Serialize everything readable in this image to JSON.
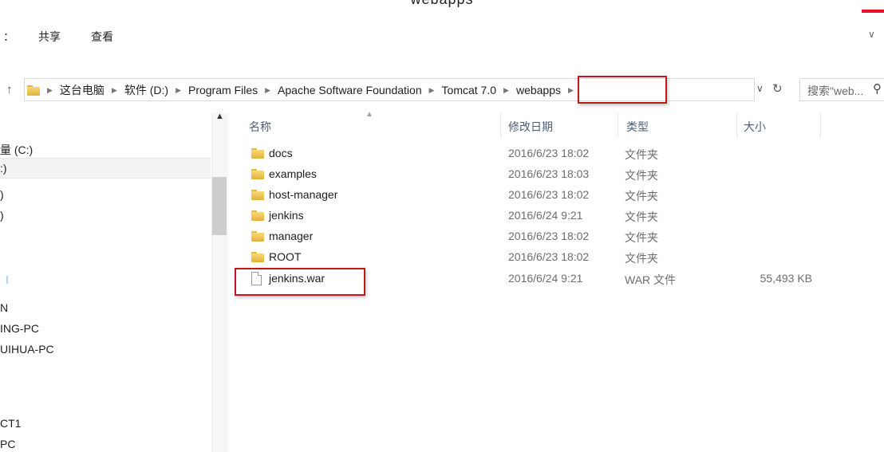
{
  "window": {
    "title": "webapps"
  },
  "menu": {
    "left_mark": "：",
    "items": [
      "共享",
      "查看"
    ],
    "toggle": "∨"
  },
  "address": {
    "up": "↑",
    "crumbs": [
      "这台电脑",
      "软件 (D:)",
      "Program Files",
      "Apache Software Foundation",
      "Tomcat 7.0",
      "webapps"
    ],
    "dropdown": "∨",
    "refresh": "↻"
  },
  "search": {
    "placeholder": "搜索\"web...",
    "icon": "search-icon"
  },
  "nav": {
    "items": [
      "量 (C:)",
      ":)",
      ")",
      ")",
      "N",
      "ING-PC",
      "UIHUA-PC",
      "CT1",
      "PC"
    ]
  },
  "columns": {
    "name": "名称",
    "date": "修改日期",
    "type": "类型",
    "size": "大小"
  },
  "files": [
    {
      "name": "docs",
      "date": "2016/6/23 18:02",
      "type": "文件夹",
      "size": "",
      "icon": "folder-icon"
    },
    {
      "name": "examples",
      "date": "2016/6/23 18:03",
      "type": "文件夹",
      "size": "",
      "icon": "folder-icon"
    },
    {
      "name": "host-manager",
      "date": "2016/6/23 18:02",
      "type": "文件夹",
      "size": "",
      "icon": "folder-icon"
    },
    {
      "name": "jenkins",
      "date": "2016/6/24 9:21",
      "type": "文件夹",
      "size": "",
      "icon": "folder-icon"
    },
    {
      "name": "manager",
      "date": "2016/6/23 18:02",
      "type": "文件夹",
      "size": "",
      "icon": "folder-icon"
    },
    {
      "name": "ROOT",
      "date": "2016/6/23 18:02",
      "type": "文件夹",
      "size": "",
      "icon": "folder-icon"
    },
    {
      "name": "jenkins.war",
      "date": "2016/6/24 9:21",
      "type": "WAR 文件",
      "size": "55,493 KB",
      "icon": "file-icon"
    }
  ],
  "colors": {
    "highlight": "#c0181f",
    "folder": "#f0c34a",
    "header_text": "#4c607a",
    "close_accent": "#e81123"
  }
}
